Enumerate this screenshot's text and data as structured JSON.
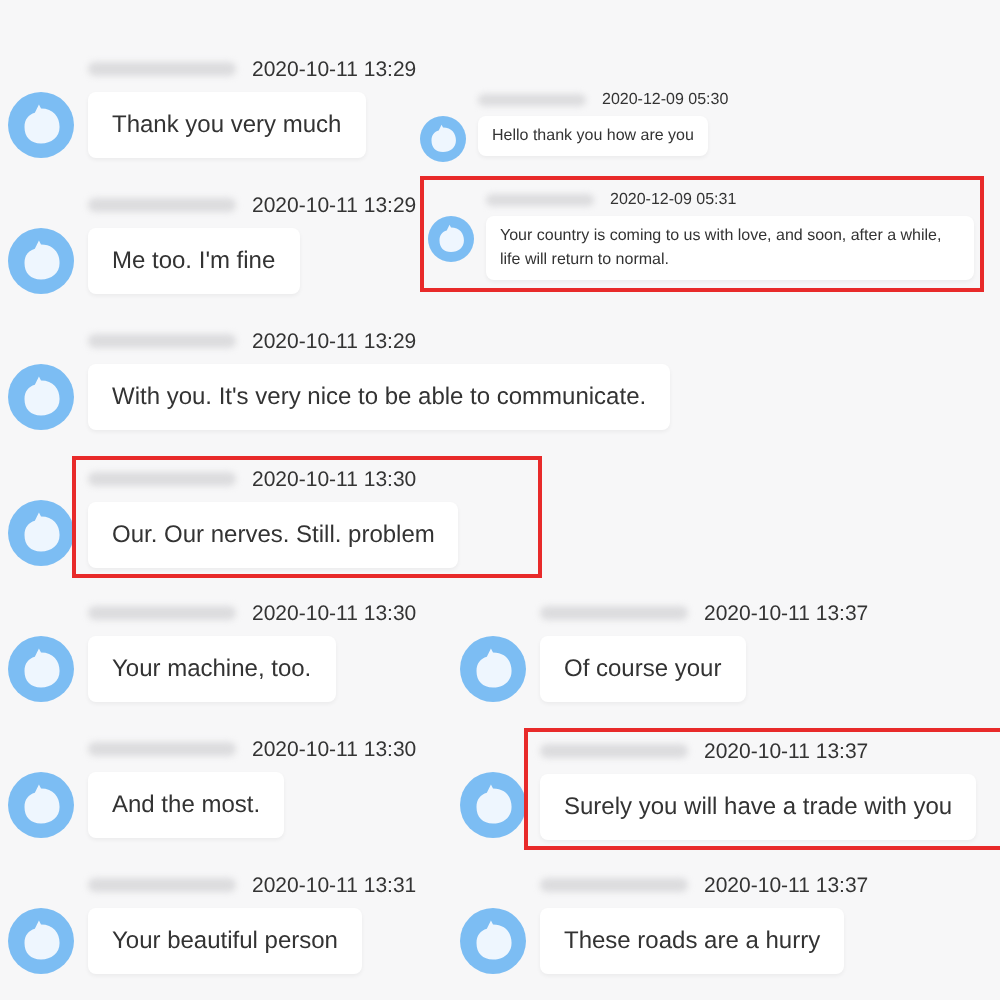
{
  "groups": [
    {
      "kind": "large",
      "messages": [
        {
          "time": "2020-10-11 13:29",
          "text": "Thank you very much",
          "highlighted": false
        },
        {
          "time": "2020-10-11 13:29",
          "text": "Me too. I'm fine",
          "highlighted": false
        },
        {
          "time": "2020-10-11 13:29",
          "text": "With you. It's very nice to be able to communicate.",
          "highlighted": false
        },
        {
          "time": "2020-10-11 13:30",
          "text": "Our. Our nerves. Still. problem",
          "highlighted": true
        },
        {
          "time": "2020-10-11 13:30",
          "text": "Your machine, too.",
          "highlighted": false
        },
        {
          "time": "2020-10-11 13:30",
          "text": "And the most.",
          "highlighted": false
        },
        {
          "time": "2020-10-11 13:31",
          "text": "Your beautiful person",
          "highlighted": false
        }
      ]
    },
    {
      "kind": "small",
      "messages": [
        {
          "time": "2020-12-09 05:30",
          "text": "Hello thank you how are you",
          "highlighted": false
        },
        {
          "time": "2020-12-09 05:31",
          "text": "Your country is coming to us with love, and soon, after a while, life will return to normal.",
          "highlighted": true
        }
      ]
    },
    {
      "kind": "large",
      "messages": [
        {
          "time": "2020-10-11 13:37",
          "text": "Of course your",
          "highlighted": false
        },
        {
          "time": "2020-10-11 13:37",
          "text": "Surely you will have a trade with you",
          "highlighted": true
        },
        {
          "time": "2020-10-11 13:37",
          "text": "These roads are a hurry",
          "highlighted": false
        }
      ]
    }
  ]
}
